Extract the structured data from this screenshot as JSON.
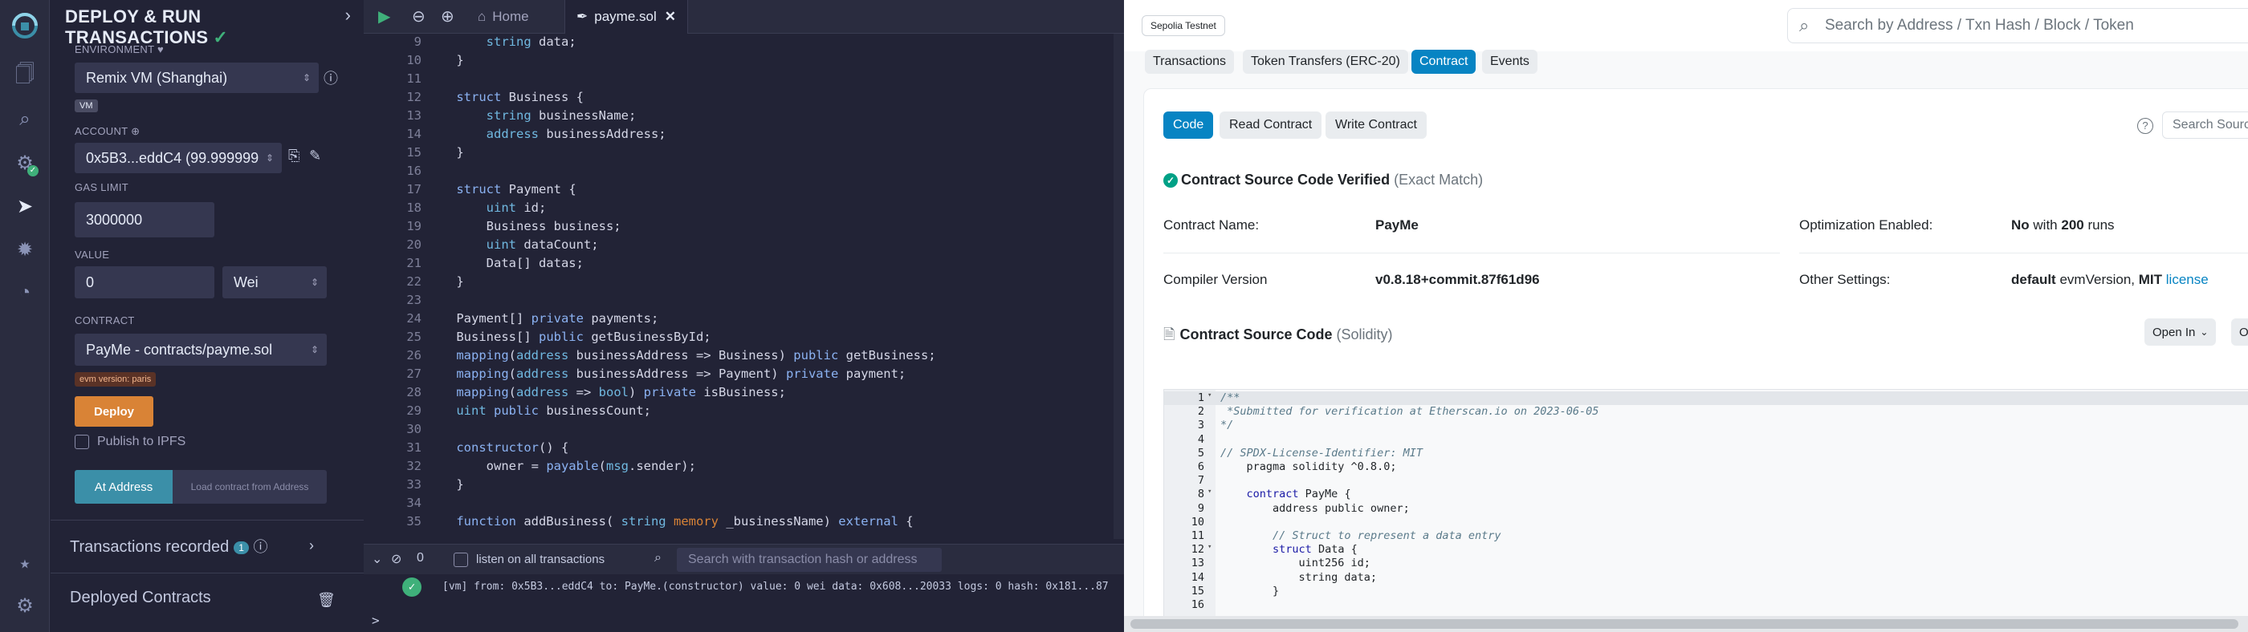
{
  "remix": {
    "panel": {
      "title": "DEPLOY & RUN TRANSACTIONS",
      "environment_label": "ENVIRONMENT",
      "environment_value": "Remix VM (Shanghai)",
      "vm_tag": "VM",
      "account_label": "ACCOUNT",
      "account_value": "0x5B3...eddC4 (99.999999",
      "gas_limit_label": "GAS LIMIT",
      "gas_limit_value": "3000000",
      "value_label": "VALUE",
      "value_amount": "0",
      "value_unit": "Wei",
      "contract_label": "CONTRACT",
      "contract_value": "PayMe - contracts/payme.sol",
      "evm_tag": "evm version: paris",
      "deploy_label": "Deploy",
      "publish_label": "Publish to IPFS",
      "at_address_label": "At Address",
      "load_contract_label": "Load contract from Address",
      "tx_recorded_label": "Transactions recorded",
      "tx_recorded_count": "1",
      "deployed_label": "Deployed Contracts"
    },
    "tabs": {
      "home": "Home",
      "file": "payme.sol"
    },
    "code_lines": [
      {
        "n": "9",
        "html": "        <span class='ty'>string</span> data;"
      },
      {
        "n": "10",
        "html": "    }"
      },
      {
        "n": "11",
        "html": ""
      },
      {
        "n": "12",
        "html": "    <span class='kw'>struct</span> Business {"
      },
      {
        "n": "13",
        "html": "        <span class='ty'>string</span> businessName;"
      },
      {
        "n": "14",
        "html": "        <span class='ty'>address</span> businessAddress;"
      },
      {
        "n": "15",
        "html": "    }"
      },
      {
        "n": "16",
        "html": ""
      },
      {
        "n": "17",
        "html": "    <span class='kw'>struct</span> Payment {"
      },
      {
        "n": "18",
        "html": "        <span class='ty'>uint</span> id;"
      },
      {
        "n": "19",
        "html": "        Business business;"
      },
      {
        "n": "20",
        "html": "        <span class='ty'>uint</span> dataCount;"
      },
      {
        "n": "21",
        "html": "        Data[] datas;"
      },
      {
        "n": "22",
        "html": "    }"
      },
      {
        "n": "23",
        "html": ""
      },
      {
        "n": "24",
        "html": "    Payment[] <span class='kw'>private</span> payments;"
      },
      {
        "n": "25",
        "html": "    Business[] <span class='kw'>public</span> getBusinessById;"
      },
      {
        "n": "26",
        "html": "    <span class='kw'>mapping</span>(<span class='ty'>address</span> businessAddress => Business) <span class='kw'>public</span> getBusiness;"
      },
      {
        "n": "27",
        "html": "    <span class='kw'>mapping</span>(<span class='ty'>address</span> businessAddress => Payment) <span class='kw'>private</span> payment;"
      },
      {
        "n": "28",
        "html": "    <span class='kw'>mapping</span>(<span class='ty'>address</span> => <span class='ty'>bool</span>) <span class='kw'>private</span> isBusiness;"
      },
      {
        "n": "29",
        "html": "    <span class='ty'>uint</span> <span class='kw'>public</span> businessCount;"
      },
      {
        "n": "30",
        "html": ""
      },
      {
        "n": "31",
        "html": "    <span class='kw'>constructor</span>() {"
      },
      {
        "n": "32",
        "html": "        owner = <span class='kw'>payable</span>(<span class='ty'>msg</span>.sender);"
      },
      {
        "n": "33",
        "html": "    }"
      },
      {
        "n": "34",
        "html": ""
      },
      {
        "n": "35",
        "html": "    <span class='kw'>function</span> addBusiness( <span class='ty'>string</span> <span class='st'>memory</span> _businessName) <span class='kw'>external</span> {"
      }
    ],
    "terminal": {
      "count": "0",
      "listen_label": "listen on all transactions",
      "search_placeholder": "Search with transaction hash or address",
      "log_line": "[vm] from: 0x5B3...eddC4 to: PayMe.(constructor) value: 0 wei data: 0x608...20033 logs: 0 hash: 0x181...87",
      "prompt": ">"
    }
  },
  "etherscan": {
    "network": "Sepolia Testnet",
    "search_placeholder": "Search by Address / Txn Hash / Block / Token",
    "tabs": [
      "Transactions",
      "Token Transfers (ERC-20)",
      "Contract",
      "Events"
    ],
    "sub_tabs": [
      "Code",
      "Read Contract",
      "Write Contract"
    ],
    "source_search_placeholder": "Search Source",
    "verified_title": "Contract Source Code Verified",
    "verified_note": "(Exact Match)",
    "contract_name_label": "Contract Name:",
    "contract_name_value": "PayMe",
    "compiler_label": "Compiler Version",
    "compiler_value": "v0.8.18+commit.87f61d96",
    "optimization_label": "Optimization Enabled:",
    "optimization_value": "No",
    "optimization_with": "with",
    "optimization_runs": "200",
    "optimization_runs_suffix": "runs",
    "other_settings_label": "Other Settings:",
    "other_default": "default",
    "other_evm": "evmVersion,",
    "other_mit": "MIT",
    "other_license": "license",
    "source_title": "Contract Source Code",
    "source_lang": "(Solidity)",
    "open_in_label": "Open In",
    "more_label": "Ou",
    "code_lines": [
      {
        "n": "1",
        "f": "▾",
        "html": "<span class='cm'>/**</span>",
        "hl": true
      },
      {
        "n": "2",
        "f": "",
        "html": "<span class='cm'> *Submitted for verification at Etherscan.io on 2023-06-05</span>"
      },
      {
        "n": "3",
        "f": "",
        "html": "<span class='cm'>*/</span>"
      },
      {
        "n": "4",
        "f": "",
        "html": ""
      },
      {
        "n": "5",
        "f": "",
        "html": "<span class='cm'>// SPDX-License-Identifier: MIT</span>"
      },
      {
        "n": "6",
        "f": "",
        "html": "    pragma solidity ^0.8.0;"
      },
      {
        "n": "7",
        "f": "",
        "html": ""
      },
      {
        "n": "8",
        "f": "▾",
        "html": "    <span class='kw2'>contract</span> PayMe {"
      },
      {
        "n": "9",
        "f": "",
        "html": "        address public owner;"
      },
      {
        "n": "10",
        "f": "",
        "html": ""
      },
      {
        "n": "11",
        "f": "",
        "html": "        <span class='cm'>// Struct to represent a data entry</span>"
      },
      {
        "n": "12",
        "f": "▾",
        "html": "        <span class='kw2'>struct</span> Data {"
      },
      {
        "n": "13",
        "f": "",
        "html": "            uint256 id;"
      },
      {
        "n": "14",
        "f": "",
        "html": "            string data;"
      },
      {
        "n": "15",
        "f": "",
        "html": "        }"
      },
      {
        "n": "16",
        "f": "",
        "html": ""
      }
    ]
  }
}
